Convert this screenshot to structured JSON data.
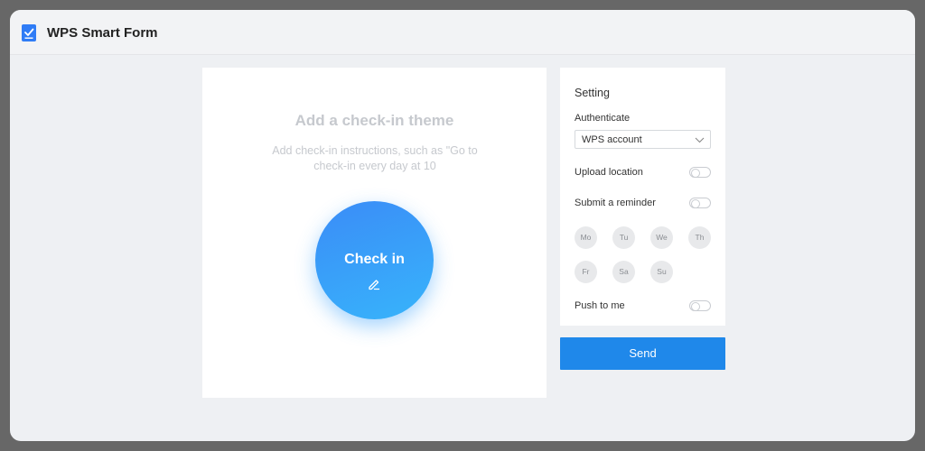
{
  "app": {
    "title": "WPS Smart Form",
    "icon": "form-checkbox-icon",
    "brand_color": "#2f7cf6"
  },
  "form": {
    "theme_title": "Add a check-in theme",
    "theme_description": "Add check-in instructions, such as \"Go to check-in every day at 10",
    "checkin_button_label": "Check in",
    "edit_icon": "pencil-icon",
    "accent_gradient": [
      "#3a8cf7",
      "#38b4fb"
    ]
  },
  "settings": {
    "title": "Setting",
    "authenticate_label": "Authenticate",
    "authenticate_value": "WPS account",
    "upload_location_label": "Upload location",
    "upload_location_on": false,
    "submit_reminder_label": "Submit a reminder",
    "submit_reminder_on": false,
    "days": [
      "Mo",
      "Tu",
      "We",
      "Th",
      "Fr",
      "Sa",
      "Su"
    ],
    "push_label": "Push to me",
    "push_on": false
  },
  "send_button": {
    "label": "Send",
    "color": "#1f88ea"
  }
}
